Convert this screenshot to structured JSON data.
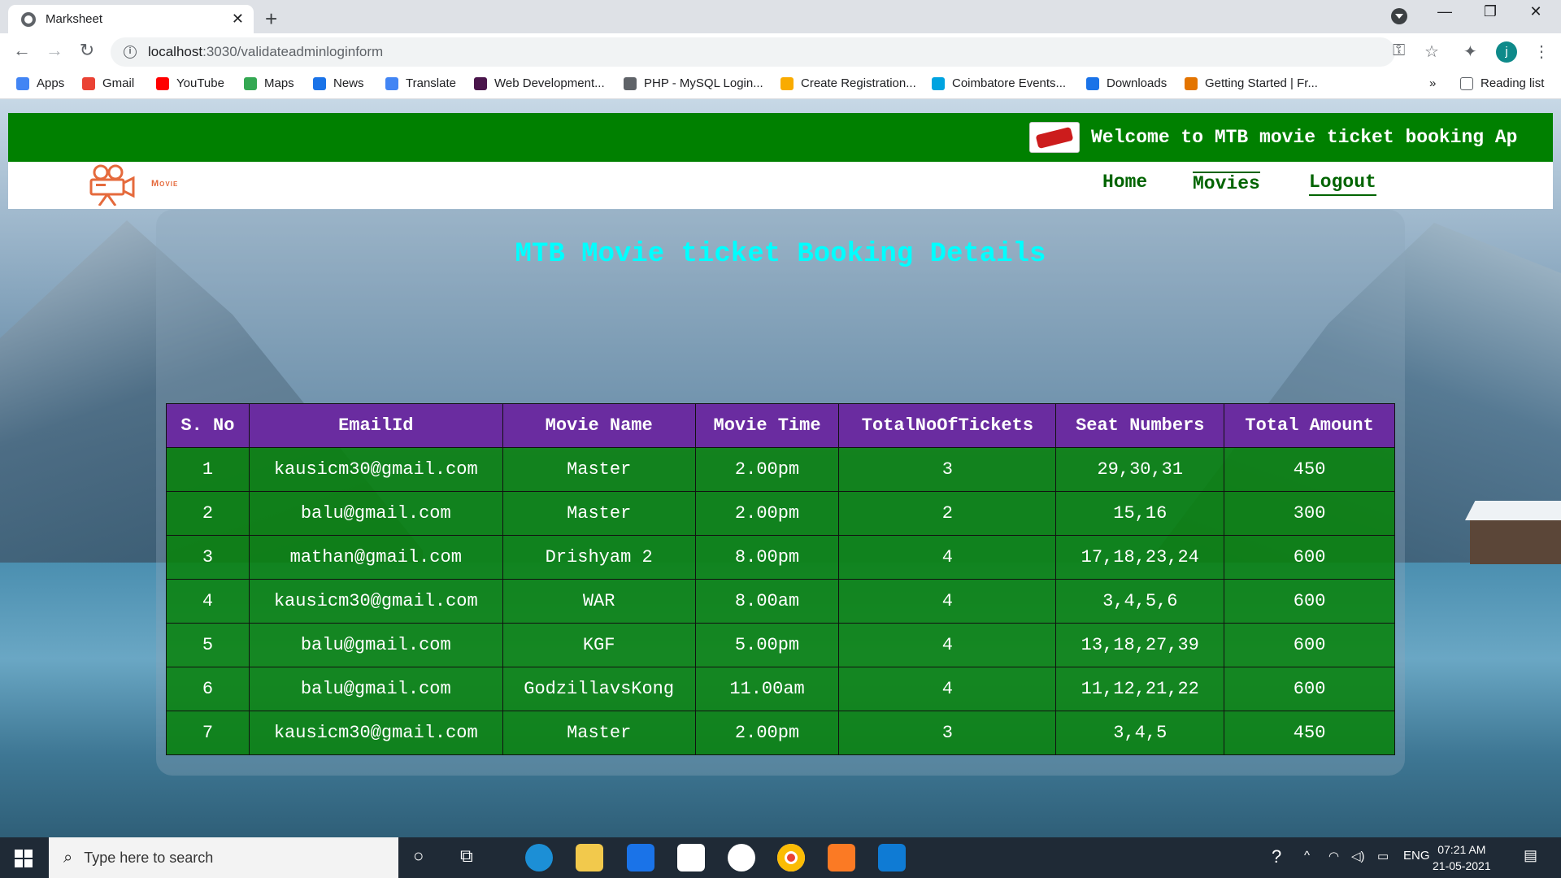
{
  "browser": {
    "tab_title": "Marksheet",
    "url_host": "localhost",
    "url_path": ":3030/validateadminloginform",
    "bookmarks": [
      {
        "label": "Apps",
        "color": "#4285f4"
      },
      {
        "label": "Gmail",
        "color": "#ea4335"
      },
      {
        "label": "YouTube",
        "color": "#ff0000"
      },
      {
        "label": "Maps",
        "color": "#34a853"
      },
      {
        "label": "News",
        "color": "#1a73e8"
      },
      {
        "label": "Translate",
        "color": "#4285f4"
      },
      {
        "label": "Web Development...",
        "color": "#4a154b"
      },
      {
        "label": "PHP - MySQL Login...",
        "color": "#5f6368"
      },
      {
        "label": "Create Registration...",
        "color": "#f9ab00"
      },
      {
        "label": "Coimbatore Events...",
        "color": "#00a3e0"
      },
      {
        "label": "Downloads",
        "color": "#1a73e8"
      },
      {
        "label": "Getting Started | Fr...",
        "color": "#e37400"
      }
    ],
    "bookmarks_more": "»",
    "reading_list": "Reading list",
    "profile_initial": "j"
  },
  "site": {
    "marquee_text": "Welcome to MTB movie ticket booking Ap",
    "logo_text": "Movie",
    "nav": [
      {
        "label": "Home"
      },
      {
        "label": "Movies"
      },
      {
        "label": "Logout"
      }
    ],
    "heading": "MTB Movie ticket Booking Details"
  },
  "table": {
    "headers": [
      "S. No",
      "EmailId",
      "Movie Name",
      "Movie Time",
      "TotalNoOfTickets",
      "Seat Numbers",
      "Total Amount"
    ],
    "rows": [
      [
        "1",
        "kausicm30@gmail.com",
        "Master",
        "2.00pm",
        "3",
        "29,30,31",
        "450"
      ],
      [
        "2",
        "balu@gmail.com",
        "Master",
        "2.00pm",
        "2",
        "15,16",
        "300"
      ],
      [
        "3",
        "mathan@gmail.com",
        "Drishyam 2",
        "8.00pm",
        "4",
        "17,18,23,24",
        "600"
      ],
      [
        "4",
        "kausicm30@gmail.com",
        "WAR",
        "8.00am",
        "4",
        "3,4,5,6",
        "600"
      ],
      [
        "5",
        "balu@gmail.com",
        "KGF",
        "5.00pm",
        "4",
        "13,18,27,39",
        "600"
      ],
      [
        "6",
        "balu@gmail.com",
        "GodzillavsKong",
        "11.00am",
        "4",
        "11,12,21,22",
        "600"
      ],
      [
        "7",
        "kausicm30@gmail.com",
        "Master",
        "2.00pm",
        "3",
        "3,4,5",
        "450"
      ]
    ]
  },
  "taskbar": {
    "search_placeholder": "Type here to search",
    "language": "ENG",
    "time": "07:21 AM",
    "date": "21-05-2021"
  },
  "colors": {
    "marquee_bg": "#008000",
    "heading": "#00ffff",
    "table_header": "#6a2ca0",
    "table_row": "#008000"
  }
}
